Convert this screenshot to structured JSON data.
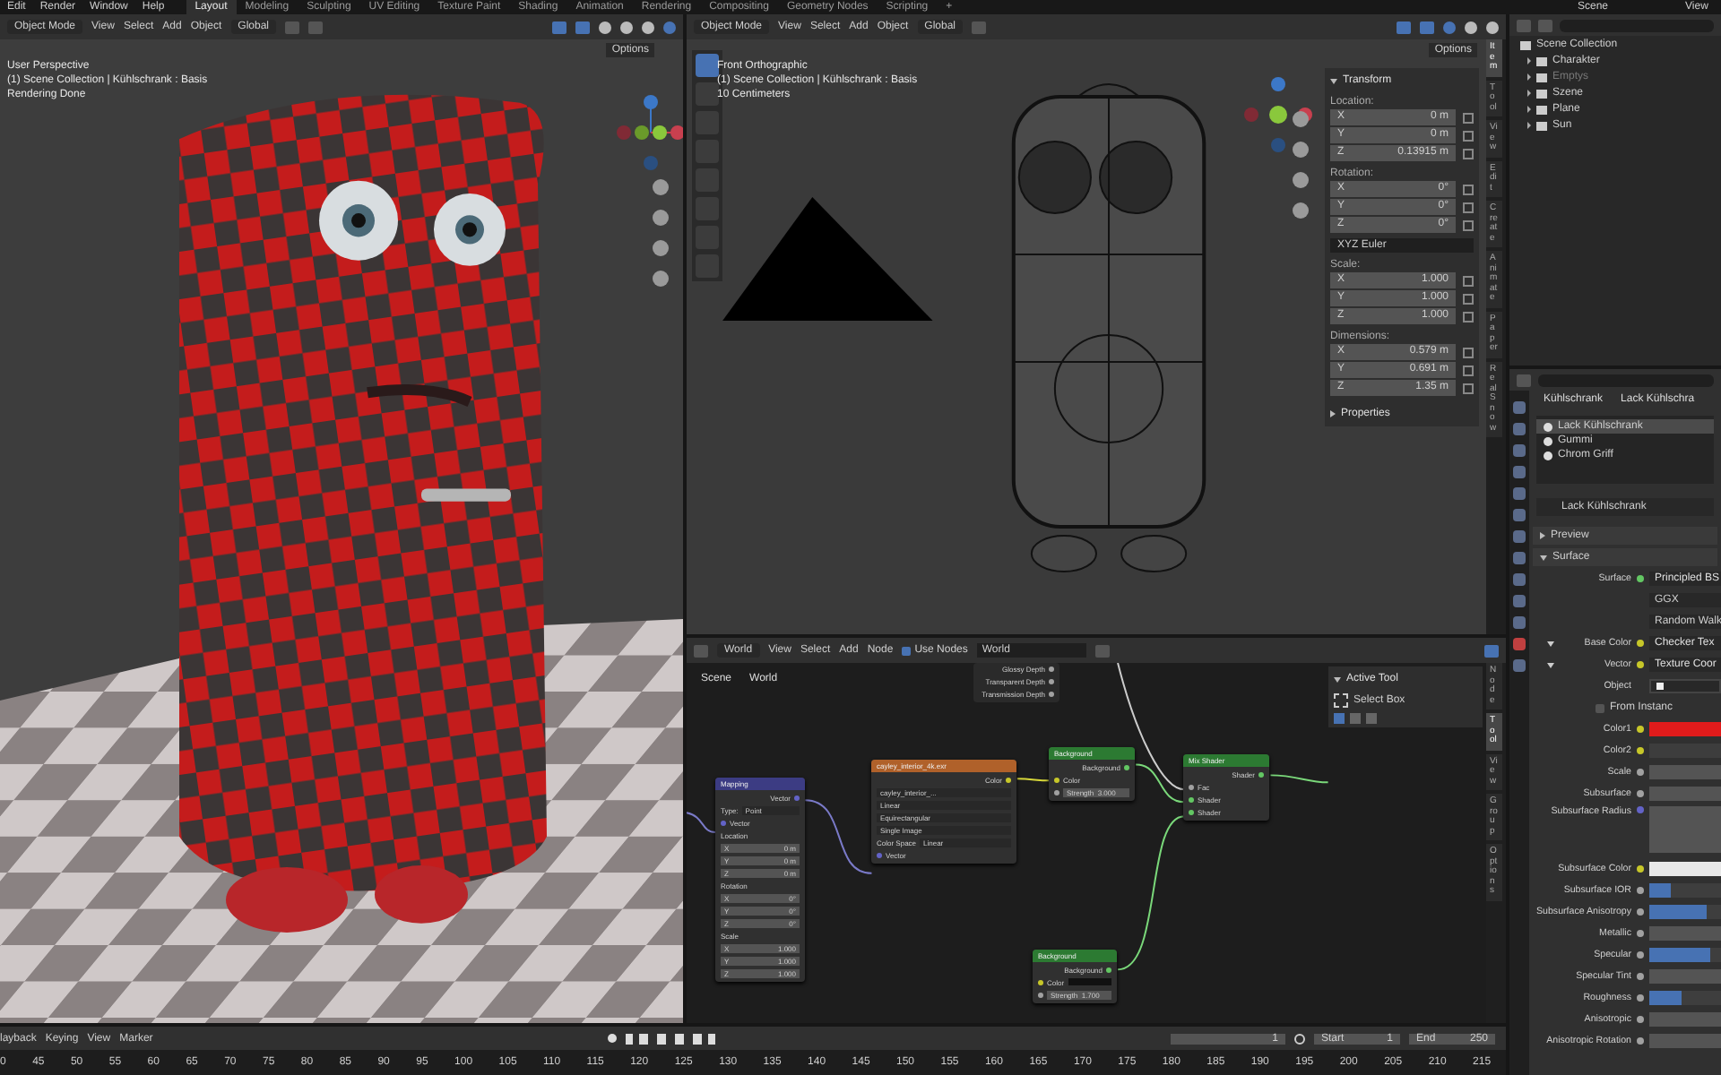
{
  "menu": [
    "Edit",
    "Render",
    "Window",
    "Help"
  ],
  "workspaces": [
    {
      "label": "Layout",
      "selected": true
    },
    {
      "label": "Modeling",
      "selected": false
    },
    {
      "label": "Sculpting",
      "selected": false
    },
    {
      "label": "UV Editing",
      "selected": false
    },
    {
      "label": "Texture Paint",
      "selected": false
    },
    {
      "label": "Shading",
      "selected": false
    },
    {
      "label": "Animation",
      "selected": false
    },
    {
      "label": "Rendering",
      "selected": false
    },
    {
      "label": "Compositing",
      "selected": false
    },
    {
      "label": "Geometry Nodes",
      "selected": false
    },
    {
      "label": "Scripting",
      "selected": false
    },
    {
      "label": "+",
      "selected": false
    }
  ],
  "top_right": {
    "scene": "Scene",
    "view_layer": "View"
  },
  "viewport_left": {
    "mode": "Object Mode",
    "menus": [
      "View",
      "Select",
      "Add",
      "Object"
    ],
    "orientation": "Global",
    "options": "Options",
    "overlay_lines": [
      "User Perspective",
      "(1) Scene Collection | Kühlschrank : Basis",
      "Rendering Done"
    ]
  },
  "viewport_right": {
    "mode": "Object Mode",
    "menus": [
      "View",
      "Select",
      "Add",
      "Object"
    ],
    "orientation": "Global",
    "options": "Options",
    "overlay_lines": [
      "Front Orthographic",
      "(1) Scene Collection | Kühlschrank : Basis",
      "10 Centimeters"
    ],
    "sidebar": {
      "panel": "Transform",
      "expanded": true,
      "groups": [
        {
          "label": "Location:",
          "fields": [
            {
              "axis": "X",
              "value": "0 m"
            },
            {
              "axis": "Y",
              "value": "0 m"
            },
            {
              "axis": "Z",
              "value": "0.13915 m"
            }
          ]
        },
        {
          "label": "Rotation:",
          "fields": [
            {
              "axis": "X",
              "value": "0°"
            },
            {
              "axis": "Y",
              "value": "0°"
            },
            {
              "axis": "Z",
              "value": "0°"
            }
          ],
          "mode": "XYZ Euler"
        },
        {
          "label": "Scale:",
          "fields": [
            {
              "axis": "X",
              "value": "1.000"
            },
            {
              "axis": "Y",
              "value": "1.000"
            },
            {
              "axis": "Z",
              "value": "1.000"
            }
          ]
        },
        {
          "label": "Dimensions:",
          "fields": [
            {
              "axis": "X",
              "value": "0.579 m"
            },
            {
              "axis": "Y",
              "value": "0.691 m"
            },
            {
              "axis": "Z",
              "value": "1.35 m"
            }
          ]
        }
      ],
      "subpanel": {
        "label": "Properties",
        "expanded": false
      }
    },
    "tabs": [
      {
        "label": "Item",
        "selected": true
      },
      {
        "label": "Tool",
        "selected": false
      },
      {
        "label": "View",
        "selected": false
      },
      {
        "label": "Edit",
        "selected": false
      },
      {
        "label": "Create",
        "selected": false
      },
      {
        "label": "Animate",
        "selected": false
      },
      {
        "label": "Paper",
        "selected": false
      },
      {
        "label": "Real Snow",
        "selected": false
      }
    ]
  },
  "node_editor": {
    "type": "World",
    "menus": [
      "View",
      "Select",
      "Add",
      "Node"
    ],
    "use_nodes": {
      "label": "Use Nodes",
      "checked": true
    },
    "world": "World",
    "breadcrumb": [
      "Scene",
      "World"
    ],
    "nodes": [
      {
        "kind": "partial",
        "rows": [
          {
            "kind": "output",
            "label": "Glossy Depth",
            "color": "#a1a1a1"
          },
          {
            "kind": "output",
            "label": "Transparent Depth",
            "color": "#a1a1a1"
          },
          {
            "kind": "output",
            "label": "Transmission Depth",
            "color": "#a1a1a1"
          }
        ]
      },
      {
        "kind": "vector",
        "title": "Mapping",
        "rows": [
          {
            "kind": "output",
            "label": "Vector",
            "color": "#6363c7"
          },
          {
            "kind": "menu",
            "label": "Type:",
            "value": "Point"
          },
          {
            "kind": "input",
            "label": "Vector",
            "color": "#6363c7"
          },
          {
            "kind": "label",
            "label": "Location"
          },
          {
            "kind": "field",
            "label": "X",
            "value": "0 m"
          },
          {
            "kind": "field",
            "label": "Y",
            "value": "0 m"
          },
          {
            "kind": "field",
            "label": "Z",
            "value": "0 m"
          },
          {
            "kind": "label",
            "label": "Rotation"
          },
          {
            "kind": "field",
            "label": "X",
            "value": "0°"
          },
          {
            "kind": "field",
            "label": "Y",
            "value": "0°"
          },
          {
            "kind": "field",
            "label": "Z",
            "value": "0°"
          },
          {
            "kind": "label",
            "label": "Scale"
          },
          {
            "kind": "field",
            "label": "X",
            "value": "1.000"
          },
          {
            "kind": "field",
            "label": "Y",
            "value": "1.000"
          },
          {
            "kind": "field",
            "label": "Z",
            "value": "1.000"
          }
        ]
      },
      {
        "kind": "texture",
        "title": "cayley_interior_4k.exr",
        "rows": [
          {
            "kind": "output",
            "label": "Color",
            "color": "#c7c729"
          },
          {
            "kind": "image",
            "value": "cayley_interior_..."
          },
          {
            "kind": "menu",
            "value": "Linear"
          },
          {
            "kind": "menu",
            "value": "Equirectangular"
          },
          {
            "kind": "menu",
            "value": "Single Image"
          },
          {
            "kind": "menu",
            "label": "Color Space",
            "value": "Linear"
          },
          {
            "kind": "input",
            "label": "Vector",
            "color": "#6363c7"
          }
        ]
      },
      {
        "kind": "shader",
        "title": "Background",
        "rows": [
          {
            "kind": "output",
            "label": "Background",
            "color": "#63c763"
          },
          {
            "kind": "input",
            "label": "Color",
            "color": "#c7c729"
          },
          {
            "kind": "slider",
            "label": "Strength",
            "value": "3.000",
            "color": "#a1a1a1"
          }
        ]
      },
      {
        "kind": "shader",
        "title": "Mix Shader",
        "rows": [
          {
            "kind": "output",
            "label": "Shader",
            "color": "#63c763"
          },
          {
            "kind": "input",
            "label": "Fac",
            "color": "#a1a1a1"
          },
          {
            "kind": "input",
            "label": "Shader",
            "color": "#63c763"
          },
          {
            "kind": "input",
            "label": "Shader",
            "color": "#63c763"
          }
        ]
      },
      {
        "kind": "shader",
        "title": "Background",
        "rows": [
          {
            "kind": "output",
            "label": "Background",
            "color": "#63c763"
          },
          {
            "kind": "swatch",
            "label": "Color",
            "color": "#c7c729"
          },
          {
            "kind": "slider",
            "label": "Strength",
            "value": "1.700",
            "color": "#a1a1a1"
          }
        ]
      }
    ],
    "active_tool": {
      "title": "Active Tool",
      "expanded": true,
      "tool": "Select Box"
    },
    "tabs": [
      {
        "label": "Node",
        "selected": false
      },
      {
        "label": "Tool",
        "selected": true
      },
      {
        "label": "View",
        "selected": false
      },
      {
        "label": "Group",
        "selected": false
      },
      {
        "label": "Options",
        "selected": false
      }
    ]
  },
  "outliner": {
    "root": "Scene Collection",
    "items": [
      {
        "label": "Charakter",
        "disabled": false
      },
      {
        "label": "Emptys",
        "disabled": true
      },
      {
        "label": "Szene",
        "disabled": false
      },
      {
        "label": "Plane",
        "disabled": false
      },
      {
        "label": "Sun",
        "disabled": false
      }
    ]
  },
  "properties": {
    "breadcrumb": [
      "Kühlschrank",
      "Lack Kühlschra"
    ],
    "slots": [
      {
        "label": "Lack Kühlschrank",
        "selected": true
      },
      {
        "label": "Gummi",
        "selected": false
      },
      {
        "label": "Chrom Griff",
        "selected": false
      }
    ],
    "material": "Lack Kühlschrank",
    "panels": [
      {
        "label": "Preview",
        "expanded": false
      },
      {
        "label": "Surface",
        "expanded": true
      }
    ],
    "rows": [
      {
        "kind": "socket",
        "label": "Surface",
        "value": "Principled BS"
      },
      {
        "kind": "menu",
        "value": "GGX"
      },
      {
        "kind": "menu",
        "value": "Random Walk"
      },
      {
        "kind": "link",
        "label": "Base Color",
        "value": "Checker Tex"
      },
      {
        "kind": "link",
        "label": "Vector",
        "value": "Texture Coor"
      },
      {
        "kind": "object",
        "label": "Object"
      },
      {
        "kind": "check",
        "label": "From Instanc",
        "checked": false
      },
      {
        "kind": "color",
        "label": "Color1",
        "color": "#e01b1b"
      },
      {
        "kind": "color",
        "label": "Color2",
        "color": "#3d3d3d"
      },
      {
        "kind": "num",
        "label": "Scale"
      },
      {
        "kind": "num",
        "label": "Subsurface"
      },
      {
        "kind": "tall",
        "label": "Subsurface Radius"
      },
      {
        "kind": "color",
        "label": "Subsurface Color",
        "color": "#e8e8e8"
      },
      {
        "kind": "bar",
        "label": "Subsurface IOR",
        "level": 0.3
      },
      {
        "kind": "bar",
        "label": "Subsurface Anisotropy",
        "level": 0.8
      },
      {
        "kind": "num",
        "label": "Metallic"
      },
      {
        "kind": "bar",
        "label": "Specular",
        "level": 0.85
      },
      {
        "kind": "num",
        "label": "Specular Tint"
      },
      {
        "kind": "bar",
        "label": "Roughness",
        "level": 0.45
      },
      {
        "kind": "num",
        "label": "Anisotropic"
      },
      {
        "kind": "num",
        "label": "Anisotropic Rotation"
      }
    ]
  },
  "timeline": {
    "menus": [
      "layback",
      "Keying",
      "View",
      "Marker"
    ],
    "frame": "1",
    "start_label": "Start",
    "start": "1",
    "end_label": "End",
    "end": "250",
    "ruler": [
      "0",
      "45",
      "50",
      "55",
      "60",
      "65",
      "70",
      "75",
      "80",
      "85",
      "90",
      "95",
      "100",
      "105",
      "110",
      "115",
      "120",
      "125",
      "130",
      "135",
      "140",
      "145",
      "150",
      "155",
      "160",
      "165",
      "170",
      "175",
      "180",
      "185",
      "190",
      "195",
      "200",
      "205",
      "210",
      "215"
    ]
  }
}
